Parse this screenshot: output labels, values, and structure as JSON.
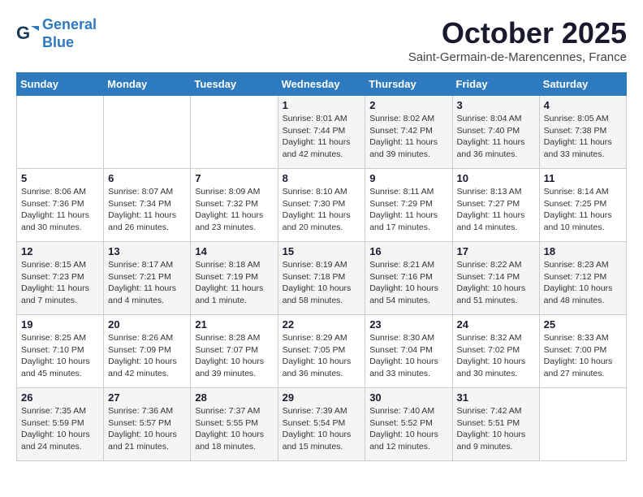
{
  "header": {
    "logo_line1": "General",
    "logo_line2": "Blue",
    "month_title": "October 2025",
    "location": "Saint-Germain-de-Marencennes, France"
  },
  "weekdays": [
    "Sunday",
    "Monday",
    "Tuesday",
    "Wednesday",
    "Thursday",
    "Friday",
    "Saturday"
  ],
  "weeks": [
    [
      {
        "day": "",
        "sunrise": "",
        "sunset": "",
        "daylight": ""
      },
      {
        "day": "",
        "sunrise": "",
        "sunset": "",
        "daylight": ""
      },
      {
        "day": "",
        "sunrise": "",
        "sunset": "",
        "daylight": ""
      },
      {
        "day": "1",
        "sunrise": "Sunrise: 8:01 AM",
        "sunset": "Sunset: 7:44 PM",
        "daylight": "Daylight: 11 hours and 42 minutes."
      },
      {
        "day": "2",
        "sunrise": "Sunrise: 8:02 AM",
        "sunset": "Sunset: 7:42 PM",
        "daylight": "Daylight: 11 hours and 39 minutes."
      },
      {
        "day": "3",
        "sunrise": "Sunrise: 8:04 AM",
        "sunset": "Sunset: 7:40 PM",
        "daylight": "Daylight: 11 hours and 36 minutes."
      },
      {
        "day": "4",
        "sunrise": "Sunrise: 8:05 AM",
        "sunset": "Sunset: 7:38 PM",
        "daylight": "Daylight: 11 hours and 33 minutes."
      }
    ],
    [
      {
        "day": "5",
        "sunrise": "Sunrise: 8:06 AM",
        "sunset": "Sunset: 7:36 PM",
        "daylight": "Daylight: 11 hours and 30 minutes."
      },
      {
        "day": "6",
        "sunrise": "Sunrise: 8:07 AM",
        "sunset": "Sunset: 7:34 PM",
        "daylight": "Daylight: 11 hours and 26 minutes."
      },
      {
        "day": "7",
        "sunrise": "Sunrise: 8:09 AM",
        "sunset": "Sunset: 7:32 PM",
        "daylight": "Daylight: 11 hours and 23 minutes."
      },
      {
        "day": "8",
        "sunrise": "Sunrise: 8:10 AM",
        "sunset": "Sunset: 7:30 PM",
        "daylight": "Daylight: 11 hours and 20 minutes."
      },
      {
        "day": "9",
        "sunrise": "Sunrise: 8:11 AM",
        "sunset": "Sunset: 7:29 PM",
        "daylight": "Daylight: 11 hours and 17 minutes."
      },
      {
        "day": "10",
        "sunrise": "Sunrise: 8:13 AM",
        "sunset": "Sunset: 7:27 PM",
        "daylight": "Daylight: 11 hours and 14 minutes."
      },
      {
        "day": "11",
        "sunrise": "Sunrise: 8:14 AM",
        "sunset": "Sunset: 7:25 PM",
        "daylight": "Daylight: 11 hours and 10 minutes."
      }
    ],
    [
      {
        "day": "12",
        "sunrise": "Sunrise: 8:15 AM",
        "sunset": "Sunset: 7:23 PM",
        "daylight": "Daylight: 11 hours and 7 minutes."
      },
      {
        "day": "13",
        "sunrise": "Sunrise: 8:17 AM",
        "sunset": "Sunset: 7:21 PM",
        "daylight": "Daylight: 11 hours and 4 minutes."
      },
      {
        "day": "14",
        "sunrise": "Sunrise: 8:18 AM",
        "sunset": "Sunset: 7:19 PM",
        "daylight": "Daylight: 11 hours and 1 minute."
      },
      {
        "day": "15",
        "sunrise": "Sunrise: 8:19 AM",
        "sunset": "Sunset: 7:18 PM",
        "daylight": "Daylight: 10 hours and 58 minutes."
      },
      {
        "day": "16",
        "sunrise": "Sunrise: 8:21 AM",
        "sunset": "Sunset: 7:16 PM",
        "daylight": "Daylight: 10 hours and 54 minutes."
      },
      {
        "day": "17",
        "sunrise": "Sunrise: 8:22 AM",
        "sunset": "Sunset: 7:14 PM",
        "daylight": "Daylight: 10 hours and 51 minutes."
      },
      {
        "day": "18",
        "sunrise": "Sunrise: 8:23 AM",
        "sunset": "Sunset: 7:12 PM",
        "daylight": "Daylight: 10 hours and 48 minutes."
      }
    ],
    [
      {
        "day": "19",
        "sunrise": "Sunrise: 8:25 AM",
        "sunset": "Sunset: 7:10 PM",
        "daylight": "Daylight: 10 hours and 45 minutes."
      },
      {
        "day": "20",
        "sunrise": "Sunrise: 8:26 AM",
        "sunset": "Sunset: 7:09 PM",
        "daylight": "Daylight: 10 hours and 42 minutes."
      },
      {
        "day": "21",
        "sunrise": "Sunrise: 8:28 AM",
        "sunset": "Sunset: 7:07 PM",
        "daylight": "Daylight: 10 hours and 39 minutes."
      },
      {
        "day": "22",
        "sunrise": "Sunrise: 8:29 AM",
        "sunset": "Sunset: 7:05 PM",
        "daylight": "Daylight: 10 hours and 36 minutes."
      },
      {
        "day": "23",
        "sunrise": "Sunrise: 8:30 AM",
        "sunset": "Sunset: 7:04 PM",
        "daylight": "Daylight: 10 hours and 33 minutes."
      },
      {
        "day": "24",
        "sunrise": "Sunrise: 8:32 AM",
        "sunset": "Sunset: 7:02 PM",
        "daylight": "Daylight: 10 hours and 30 minutes."
      },
      {
        "day": "25",
        "sunrise": "Sunrise: 8:33 AM",
        "sunset": "Sunset: 7:00 PM",
        "daylight": "Daylight: 10 hours and 27 minutes."
      }
    ],
    [
      {
        "day": "26",
        "sunrise": "Sunrise: 7:35 AM",
        "sunset": "Sunset: 5:59 PM",
        "daylight": "Daylight: 10 hours and 24 minutes."
      },
      {
        "day": "27",
        "sunrise": "Sunrise: 7:36 AM",
        "sunset": "Sunset: 5:57 PM",
        "daylight": "Daylight: 10 hours and 21 minutes."
      },
      {
        "day": "28",
        "sunrise": "Sunrise: 7:37 AM",
        "sunset": "Sunset: 5:55 PM",
        "daylight": "Daylight: 10 hours and 18 minutes."
      },
      {
        "day": "29",
        "sunrise": "Sunrise: 7:39 AM",
        "sunset": "Sunset: 5:54 PM",
        "daylight": "Daylight: 10 hours and 15 minutes."
      },
      {
        "day": "30",
        "sunrise": "Sunrise: 7:40 AM",
        "sunset": "Sunset: 5:52 PM",
        "daylight": "Daylight: 10 hours and 12 minutes."
      },
      {
        "day": "31",
        "sunrise": "Sunrise: 7:42 AM",
        "sunset": "Sunset: 5:51 PM",
        "daylight": "Daylight: 10 hours and 9 minutes."
      },
      {
        "day": "",
        "sunrise": "",
        "sunset": "",
        "daylight": ""
      }
    ]
  ]
}
